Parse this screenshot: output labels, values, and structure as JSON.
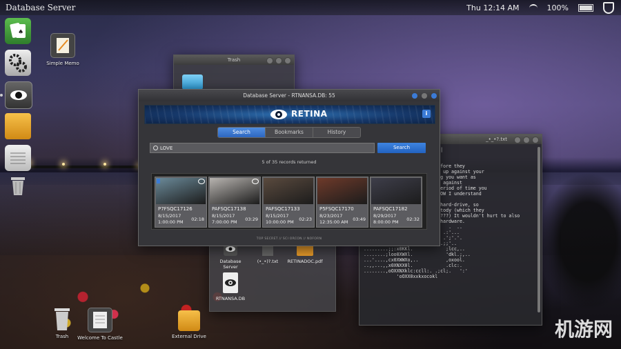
{
  "menubar": {
    "app_title": "Database Server",
    "clock": "Thu 12:14 AM",
    "battery": "100%"
  },
  "desktop": {
    "simple_memo": "Simple Memo",
    "trash": "Trash",
    "welcome": "Welcome To Castle",
    "external_drive": "External Drive"
  },
  "trash_window": {
    "title": "Trash"
  },
  "files_window": {
    "items": [
      "Database Server",
      "(•_•)?.txt",
      "RETINADOC.pdf",
      "RTNANSA.DB"
    ]
  },
  "terminal": {
    "title": "_•_•?.txt",
    "lines": [
      " /     \\  <   /\\ \\ \\ | /| _.|",
      " \\  \\  . \\  / ____ \\| \\ \\|",
      "   \\_\\  |_|\\_\\_/    \\_\\_\\",
      "",
      "           dump of Retina before they",
      "           this is what came up against your",
      "           this is everything you want as",
      "           already partioned against",
      "           es to cover the period of time you",
      "           of the faces -- NOW I understand",
      "           stuff!",
      "",
      "           t will erase the hard-drive, so",
      "           take you into custody (which they",
      "will -- you know this, right???) It wouldn't hurt to also",
      "burn/dissolve/pulverize the hardware.",
      "",
      "............................   .  ..",
      "..............'';loc:;....   .:'...",
      "............,llc:;......     .';'.'.",
      "............lkOxl'        .'.;;'..",
      ".........;;:x0KKl.            ;lcc,..",
      "........;loo0XWXl.            'dkl.;,..",
      "...'....,cx0XWWXo,..          ,oxool.",
      "..,,...,,x0XNXX0l.            .clc:.",
      "........,oOXXNXklc:ccll:. .;cl;.   ':'",
      "            'oOXX0xxkxocokl"
    ]
  },
  "db_window": {
    "title": "Database Server - RTNANSA.DB: 55",
    "brand": "RETINA",
    "tabs": [
      "Search",
      "Bookmarks",
      "History"
    ],
    "search_value": "LOVE",
    "search_button": "Search",
    "records_status": "5 of 35 records returned",
    "footer": "TOP SECRET // SCI ORCON // NOFORN",
    "results": [
      {
        "id": "P7FSQC17126",
        "date": "8/15/2017",
        "time": "1:00:00 PM",
        "duration": "02:18",
        "color": "#6b8a99"
      },
      {
        "id": "PAFSQC17138",
        "date": "8/15/2017",
        "time": "7:00:00 PM",
        "duration": "03:29",
        "color": "#b8b4b0"
      },
      {
        "id": "PAFSQC17133",
        "date": "8/15/2017",
        "time": "10:00:00 PM",
        "duration": "02:23",
        "color": "#5a4a3e"
      },
      {
        "id": "P5FSQC17170",
        "date": "8/23/2017",
        "time": "12:35:00 AM",
        "duration": "03:49",
        "color": "#6e3a2a"
      },
      {
        "id": "PAFSQC17182",
        "date": "8/29/2017",
        "time": "8:00:00 PM",
        "duration": "02:32",
        "color": "#3e3e4a"
      }
    ]
  },
  "watermark": "机游网"
}
